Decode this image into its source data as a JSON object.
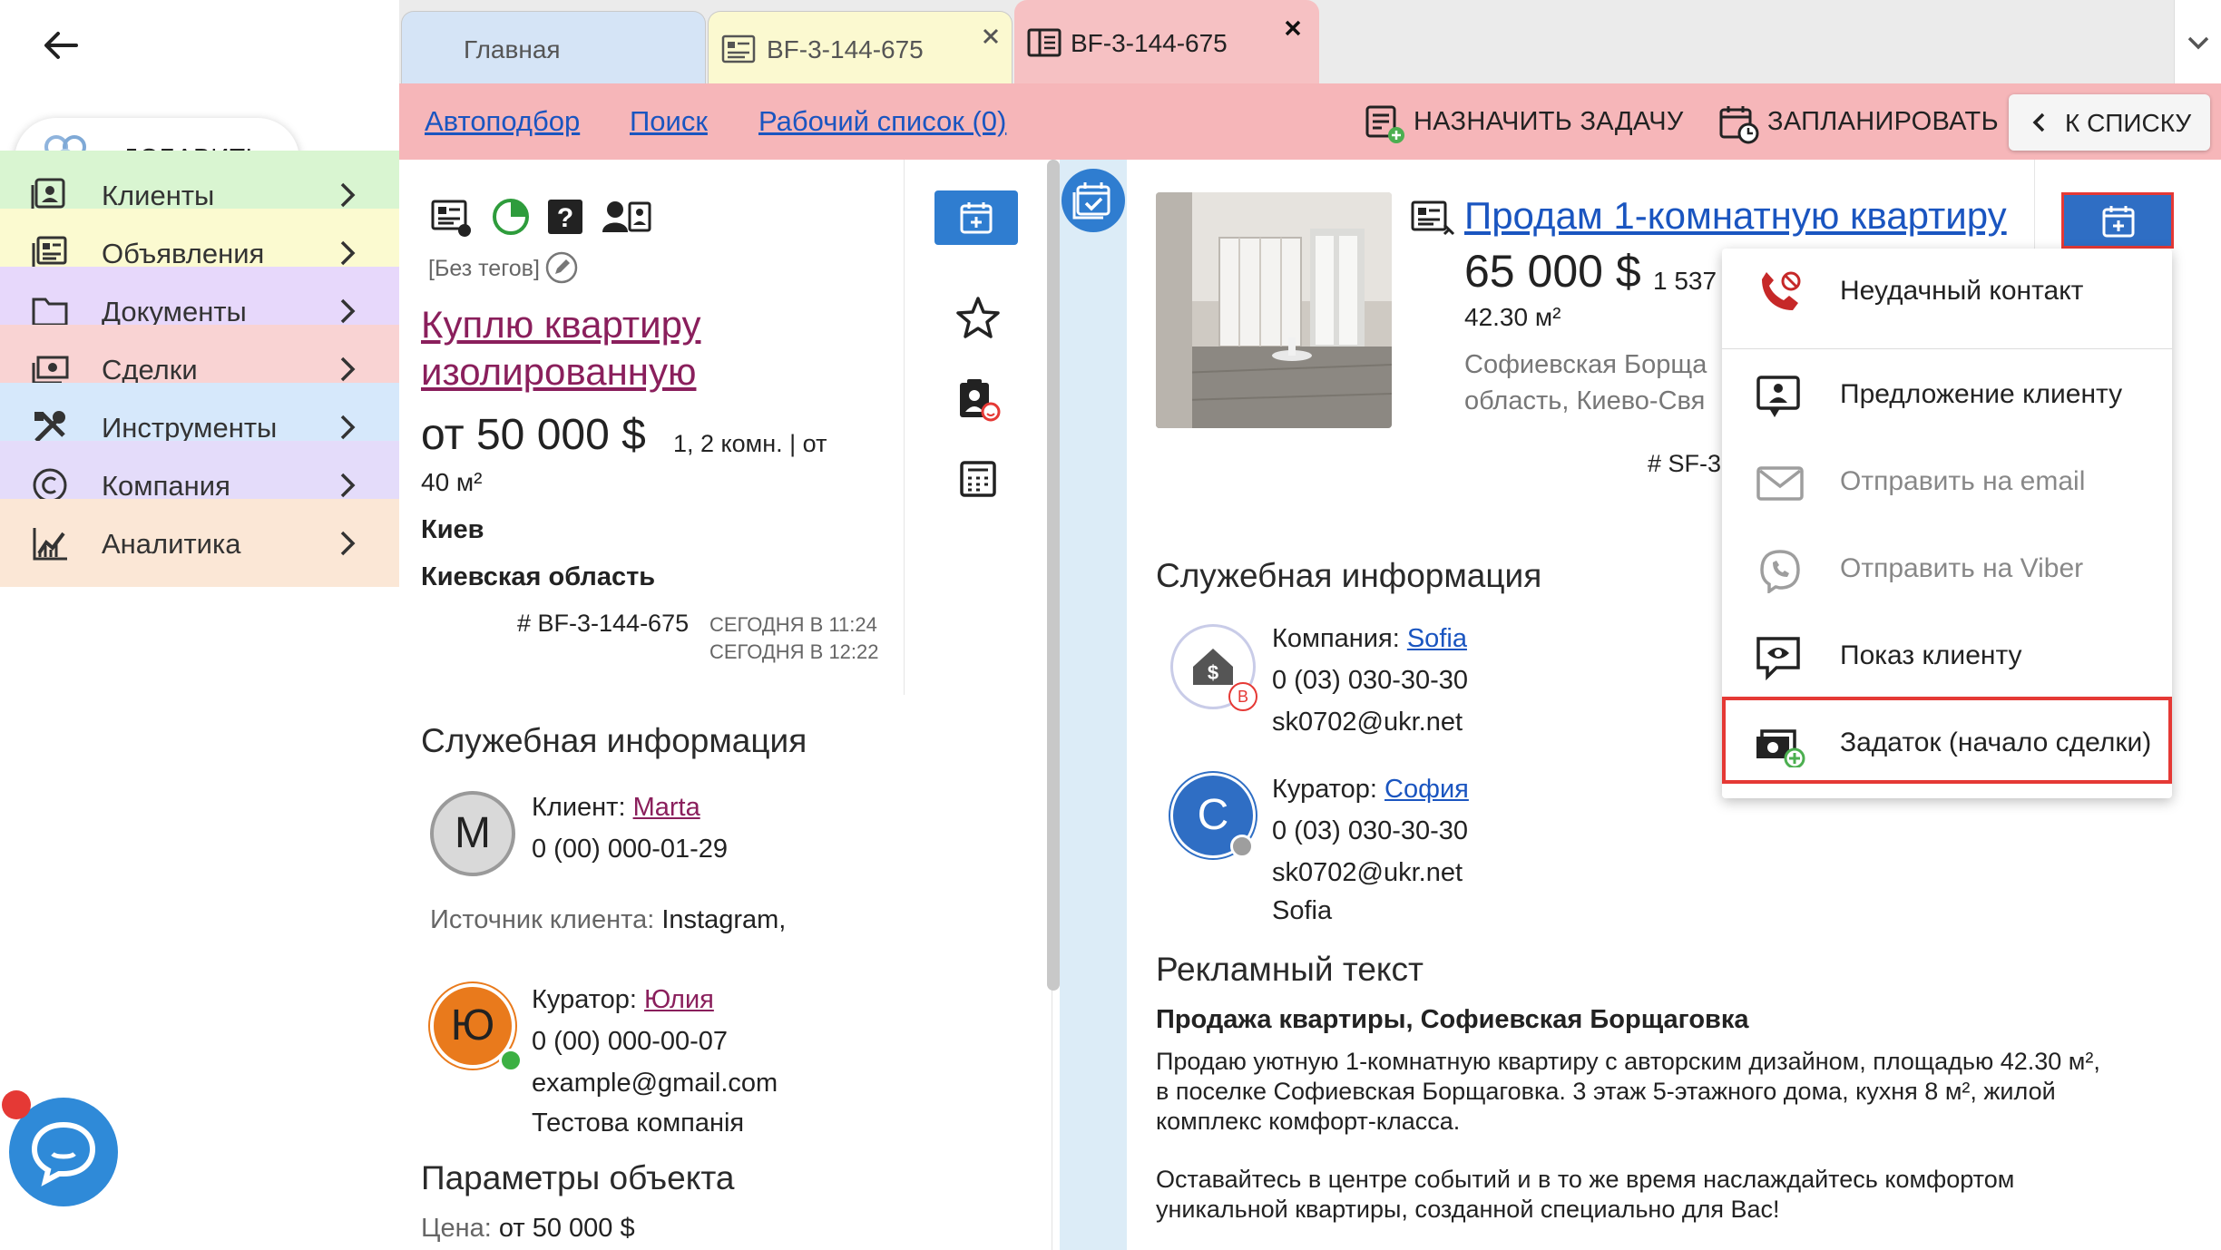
{
  "sidebar": {
    "add_label": "ДОБАВИТЬ",
    "items": [
      {
        "label": "Клиенты",
        "icon": "clients-icon",
        "color": "#d9f5d1"
      },
      {
        "label": "Объявления",
        "icon": "listings-icon",
        "color": "#fbfad0"
      },
      {
        "label": "Документы",
        "icon": "folder-icon",
        "color": "#e7d8fb"
      },
      {
        "label": "Сделки",
        "icon": "deals-icon",
        "color": "#f9d3d3"
      },
      {
        "label": "Инструменты",
        "icon": "tools-icon",
        "color": "#d6e8fb"
      },
      {
        "label": "Компания",
        "icon": "copyright-icon",
        "color": "#e4dcfa"
      },
      {
        "label": "Аналитика",
        "icon": "analytics-icon",
        "color": "#fbe7d6"
      }
    ]
  },
  "tabs": [
    {
      "label": "Главная"
    },
    {
      "label": "BF-3-144-675"
    },
    {
      "label": "BF-3-144-675"
    }
  ],
  "actionbar": {
    "links": [
      "Автоподбор",
      "Поиск",
      "Рабочий список (0)"
    ],
    "assign_task": "НАЗНАЧИТЬ ЗАДАЧУ",
    "schedule": "ЗАПЛАНИРОВАТЬ",
    "to_list": "К СПИСКУ"
  },
  "request": {
    "no_tags": "[Без тегов]",
    "title_line1": "Куплю квартиру",
    "title_line2": "изолированную",
    "price": "от 50 000 $",
    "rooms": "1, 2 комн. | от",
    "area": "40 м²",
    "city": "Киев",
    "region": "Киевская область",
    "code": "# BF-3-144-675",
    "created": "СЕГОДНЯ В 11:24",
    "updated": "СЕГОДНЯ В 12:22",
    "service_h": "Служебная информация",
    "client_label": "Клиент:",
    "client_name": "Marta",
    "client_initial": "M",
    "client_phone": "0 (00) 000-01-29",
    "source_label": "Источник клиента:",
    "source_value": "Instagram,",
    "curator_label": "Куратор:",
    "curator_name": "Юлия",
    "curator_initial": "Ю",
    "curator_phone": "0 (00) 000-00-07",
    "curator_email": "example@gmail.com",
    "curator_company": "Тестова компанія",
    "params_h": "Параметры объекта",
    "price_label": "Цена:",
    "price_value": "от 50 000 $"
  },
  "listing": {
    "title": "Продам 1-комнатную квартиру",
    "price": "65 000 $",
    "price_m2": "1 537",
    "area": "42.30 м²",
    "address1": "Софиевская Борща",
    "address2": "область, Киево-Свя",
    "code": "# SF-3-",
    "service_h": "Служебная информация",
    "company_label": "Компания:",
    "company_name": "Sofia",
    "company_phone": "0 (03) 030-30-30",
    "company_email": "sk0702@ukr.net",
    "company_badge": "B",
    "curator_label": "Куратор:",
    "curator_name": "София",
    "curator_initial": "C",
    "curator_phone": "0 (03) 030-30-30",
    "curator_email": "sk0702@ukr.net",
    "curator_company": "Sofia",
    "ad_h": "Рекламный текст",
    "ad_title": "Продажа квартиры, Софиевская Борщаговка",
    "ad_p1_l1": "Продаю уютную 1-комнатную квартиру с авторским дизайном, площадью 42.30 м²,",
    "ad_p1_l2": "в поселке Софиевская Борщаговка. 3 этаж 5-этажного дома, кухня 8 м², жилой",
    "ad_p1_l3": "комплекс комфорт-класса.",
    "ad_p2_l1": "Оставайтесь в центре событий и в то же время наслаждайтесь комфортом",
    "ad_p2_l2": "уникальной квартиры, созданной специально для Вас!"
  },
  "dropdown": [
    {
      "label": "Неудачный контакт",
      "icon": "failed-call-icon",
      "disabled": false
    },
    {
      "label": "Предложение клиенту",
      "icon": "offer-client-icon",
      "disabled": false
    },
    {
      "label": "Отправить на email",
      "icon": "email-icon",
      "disabled": true
    },
    {
      "label": "Отправить на Viber",
      "icon": "viber-icon",
      "disabled": true
    },
    {
      "label": "Показ клиенту",
      "icon": "showing-icon",
      "disabled": false
    },
    {
      "label": "Задаток (начало сделки)",
      "icon": "deposit-icon",
      "disabled": false
    }
  ]
}
